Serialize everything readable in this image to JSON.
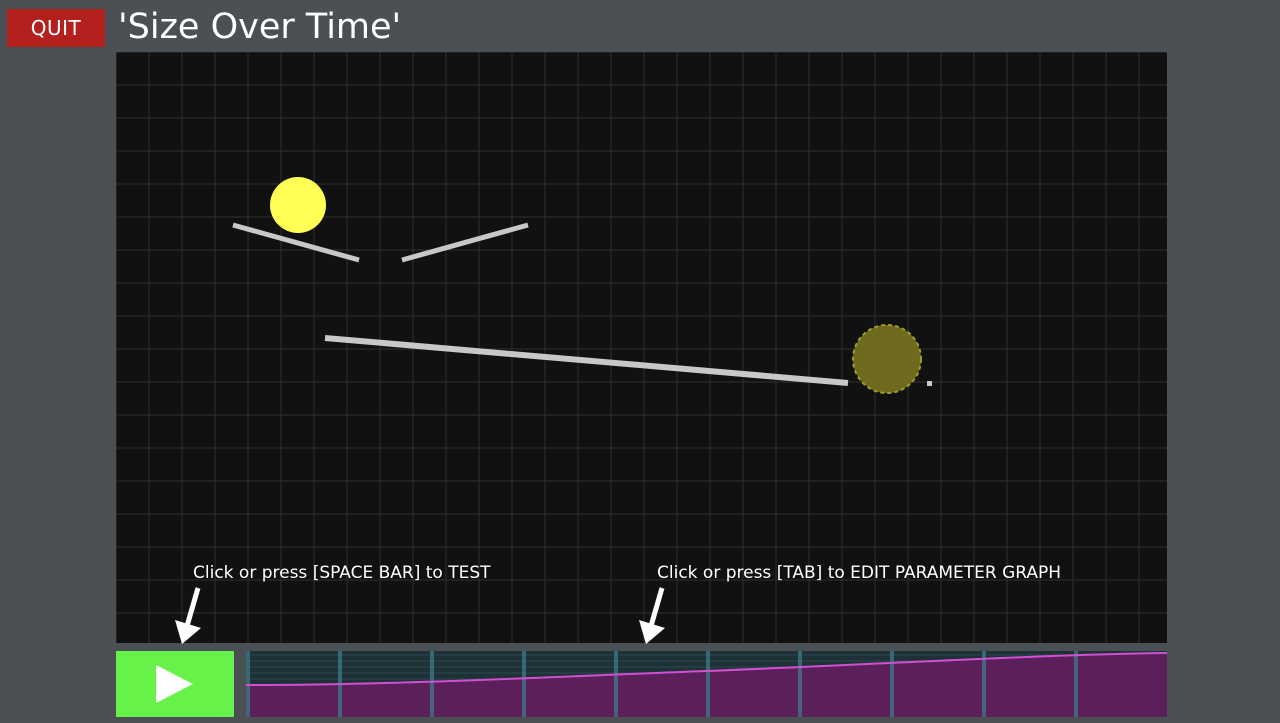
{
  "header": {
    "quit_label": "QUIT",
    "level_title": "'Size Over Time'"
  },
  "hints": {
    "test": "Click or press [SPACE BAR] to TEST",
    "edit_graph": "Click or press [TAB] to EDIT PARAMETER GRAPH"
  },
  "controls": {
    "play_icon": "play-icon"
  },
  "colors": {
    "background": "#4b5055",
    "quit_button": "#b3201d",
    "playfield": "#111111",
    "ball": "#ffff55",
    "goal_ball": "#6e6a1e",
    "platform": "#c8c8c8",
    "play_button": "#67f24a",
    "graph_curve": "#d050d0"
  }
}
